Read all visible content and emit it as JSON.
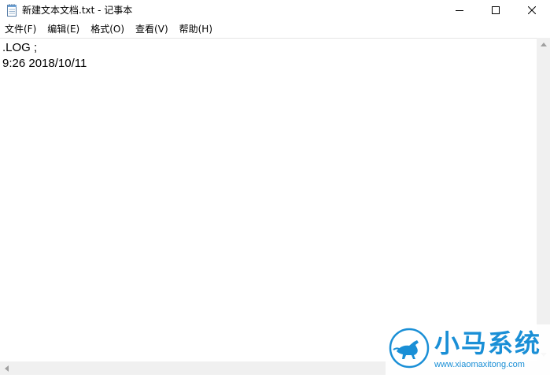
{
  "window": {
    "title": "新建文本文档.txt - 记事本",
    "icon": "notepad-icon",
    "controls": {
      "minimize_icon": "minimize-icon",
      "maximize_icon": "maximize-icon",
      "close_icon": "close-icon"
    }
  },
  "menu": {
    "items": [
      {
        "label": "文件(F)"
      },
      {
        "label": "编辑(E)"
      },
      {
        "label": "格式(O)"
      },
      {
        "label": "查看(V)"
      },
      {
        "label": "帮助(H)"
      }
    ]
  },
  "editor": {
    "lines": [
      ".LOG ;",
      "9:26 2018/10/11"
    ]
  },
  "watermark": {
    "title": "小马系统",
    "url": "www.xiaomaxitong.com",
    "brand_color": "#1a8fd6",
    "logo_icon": "horse-logo-icon"
  }
}
